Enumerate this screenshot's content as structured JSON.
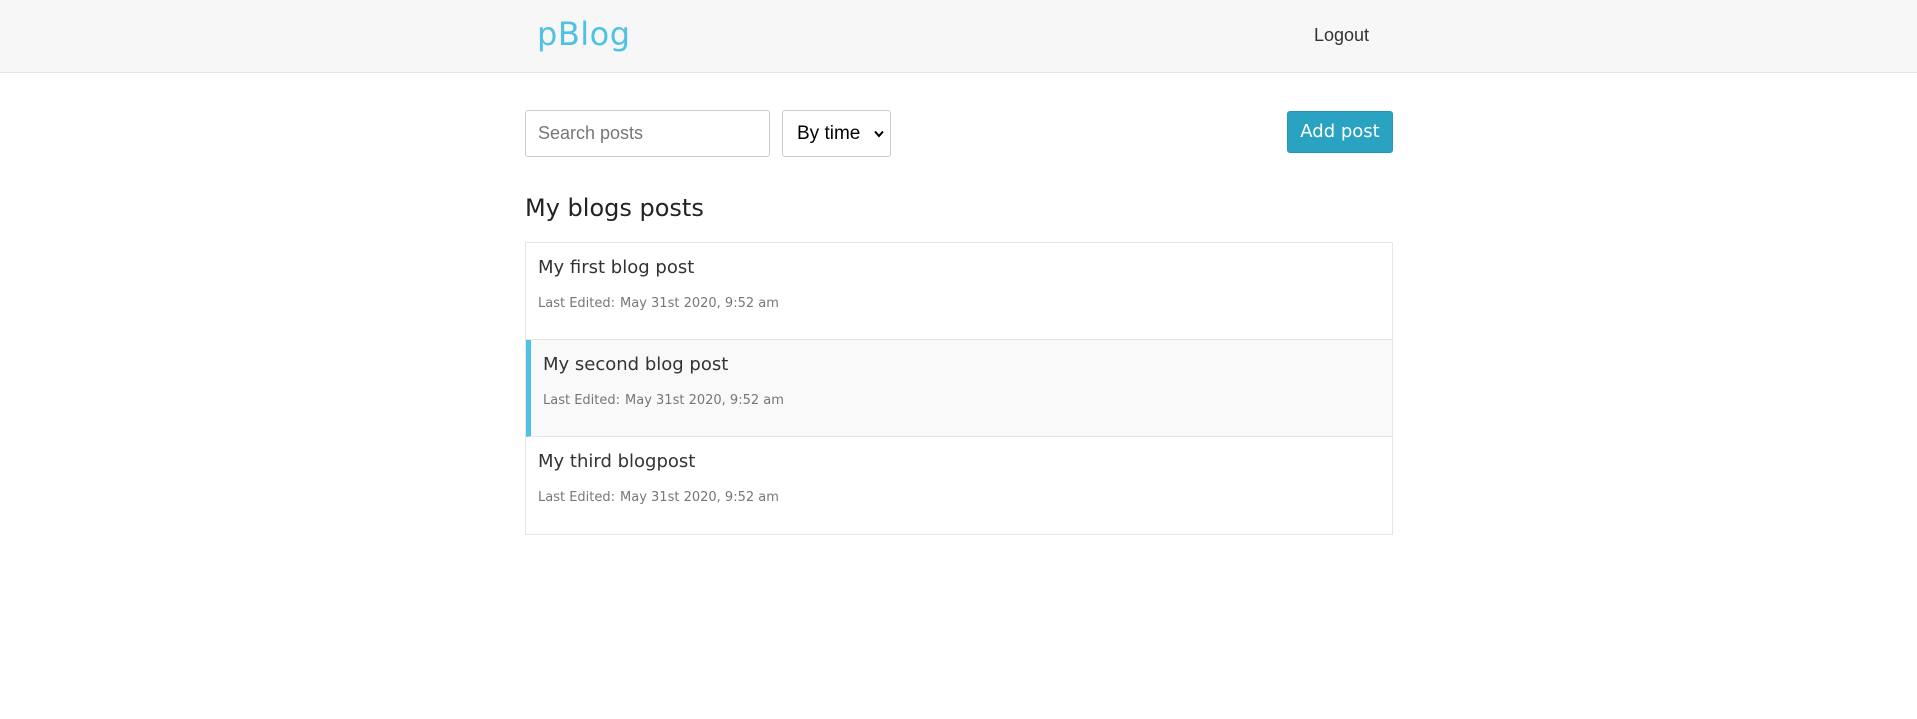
{
  "navbar": {
    "brand": "pBlog",
    "logout_label": "Logout"
  },
  "toolbar": {
    "search_placeholder": "Search posts",
    "search_value": "",
    "sort_selected": "By time",
    "add_post_label": "Add post"
  },
  "main": {
    "section_title": "My blogs posts",
    "posts": [
      {
        "title": "My first blog post",
        "edited_label": "Last Edited:",
        "edited_time": "May 31st 2020, 9:52 am",
        "active": false
      },
      {
        "title": "My second blog post",
        "edited_label": "Last Edited:",
        "edited_time": "May 31st 2020, 9:52 am",
        "active": true
      },
      {
        "title": "My third blogpost",
        "edited_label": "Last Edited:",
        "edited_time": "May 31st 2020, 9:52 am",
        "active": false
      }
    ]
  },
  "icons": {
    "sort_chevron": "chevron-down-icon"
  },
  "colors": {
    "brand": "#4fc1e5",
    "primary_button": "#2aa3c2",
    "active_indicator": "#4fc1e5",
    "navbar_bg": "#f7f7f7"
  }
}
